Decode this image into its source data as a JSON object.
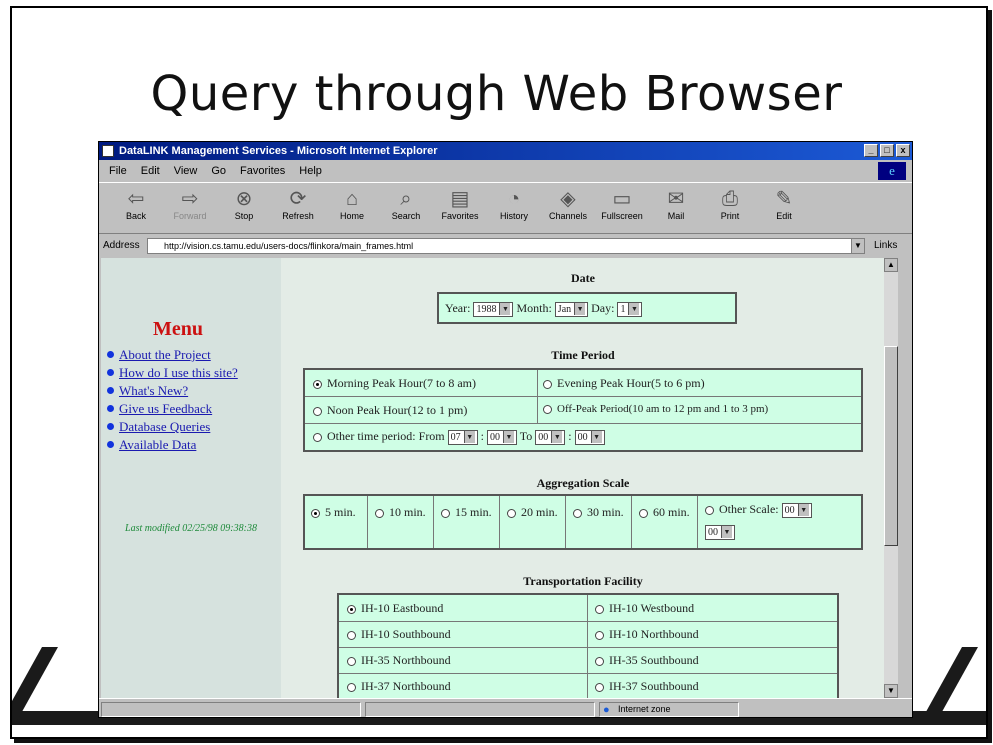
{
  "slide": {
    "title": "Query through Web Browser"
  },
  "window": {
    "title": "DataLINK Management Services - Microsoft Internet Explorer",
    "controls": [
      "_",
      "□",
      "x"
    ]
  },
  "menubar": [
    "File",
    "Edit",
    "View",
    "Go",
    "Favorites",
    "Help"
  ],
  "toolbar": [
    {
      "label": "Back",
      "icon": "back-arrow-icon",
      "glyph": "⇦"
    },
    {
      "label": "Forward",
      "icon": "forward-arrow-icon",
      "glyph": "⇨"
    },
    {
      "label": "Stop",
      "icon": "stop-icon",
      "glyph": "⊗"
    },
    {
      "label": "Refresh",
      "icon": "refresh-icon",
      "glyph": "⟳"
    },
    {
      "label": "Home",
      "icon": "home-icon",
      "glyph": "⌂"
    },
    {
      "label": "Search",
      "icon": "search-icon",
      "glyph": "⌕"
    },
    {
      "label": "Favorites",
      "icon": "favorites-icon",
      "glyph": "▤"
    },
    {
      "label": "History",
      "icon": "history-icon",
      "glyph": "◔"
    },
    {
      "label": "Channels",
      "icon": "channels-icon",
      "glyph": "◈"
    },
    {
      "label": "Fullscreen",
      "icon": "fullscreen-icon",
      "glyph": "▭"
    },
    {
      "label": "Mail",
      "icon": "mail-icon",
      "glyph": "✉"
    },
    {
      "label": "Print",
      "icon": "print-icon",
      "glyph": "⎙"
    },
    {
      "label": "Edit",
      "icon": "edit-icon",
      "glyph": "✎"
    }
  ],
  "address": {
    "label": "Address",
    "url": "http://vision.cs.tamu.edu/users-docs/flinkora/main_frames.html",
    "links_label": "Links"
  },
  "sidebar": {
    "title": "Menu",
    "items": [
      "About the Project",
      "How do I use this site?",
      "What's New?",
      "Give us Feedback",
      "Database Queries",
      "Available Data"
    ],
    "last_modified": "Last modified 02/25/98 09:38:38"
  },
  "date": {
    "heading": "Date",
    "year_label": "Year:",
    "year_value": "1988",
    "month_label": "Month:",
    "month_value": "Jan",
    "day_label": "Day:",
    "day_value": "1"
  },
  "time_period": {
    "heading": "Time Period",
    "opt_morning": "Morning Peak Hour(7 to 8 am)",
    "opt_evening": "Evening Peak Hour(5 to 6 pm)",
    "opt_noon": "Noon Peak Hour(12 to 1 pm)",
    "opt_offpeak": "Off-Peak Period(10 am to 12 pm and 1 to 3 pm)",
    "opt_other": "Other time period: From",
    "from_hour": "07",
    "from_min": "00",
    "to_label": "To",
    "to_hour": "00",
    "to_min": "00",
    "colon": ":"
  },
  "aggregation": {
    "heading": "Aggregation Scale",
    "opt5": "5 min.",
    "opt10": "10 min.",
    "opt15": "15 min.",
    "opt20": "20 min.",
    "opt30": "30 min.",
    "opt60": "60 min.",
    "other": "Other Scale:",
    "other_val1": "00",
    "other_val2": "00"
  },
  "facility": {
    "heading": "Transportation Facility",
    "ih10_east": "IH-10 Eastbound",
    "ih10_west": "IH-10 Westbound",
    "ih10_south": "IH-10 Southbound",
    "ih10_north": "IH-10 Northbound",
    "ih35_north": "IH-35 Northbound",
    "ih35_south": "IH-35 Southbound",
    "ih37_north": "IH-37 Northbound",
    "ih37_south": "IH-37 Southbound"
  },
  "status": {
    "zone": "Internet zone"
  }
}
